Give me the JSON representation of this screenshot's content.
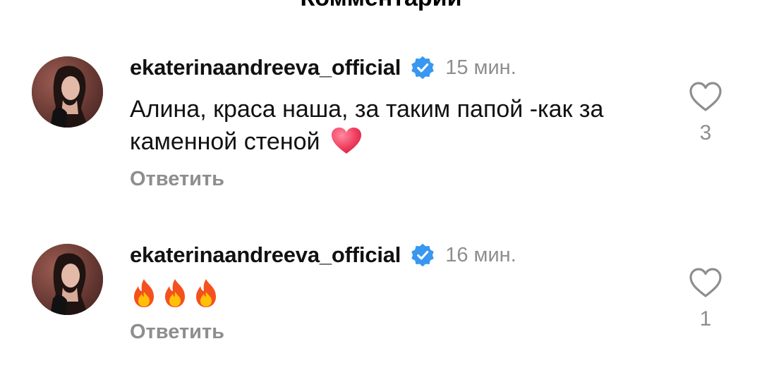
{
  "header": {
    "title": "Комментарии"
  },
  "colors": {
    "verified_badge": "#3897f0",
    "secondary_text": "#8e8e8e",
    "primary_text": "#111111",
    "heart_emoji": "#e8304f"
  },
  "comments": [
    {
      "username": "ekaterinaandreeva_official",
      "verified": true,
      "time": "15 мин.",
      "text": "Алина, краса наша, за таким папой -как за каменной стеной",
      "emoji": "heart-emoji",
      "reply_label": "Ответить",
      "like_count": "3"
    },
    {
      "username": "ekaterinaandreeva_official",
      "verified": true,
      "time": "16 мин.",
      "text": "",
      "emoji": "fire-emoji x3",
      "reply_label": "Ответить",
      "like_count": "1"
    }
  ]
}
